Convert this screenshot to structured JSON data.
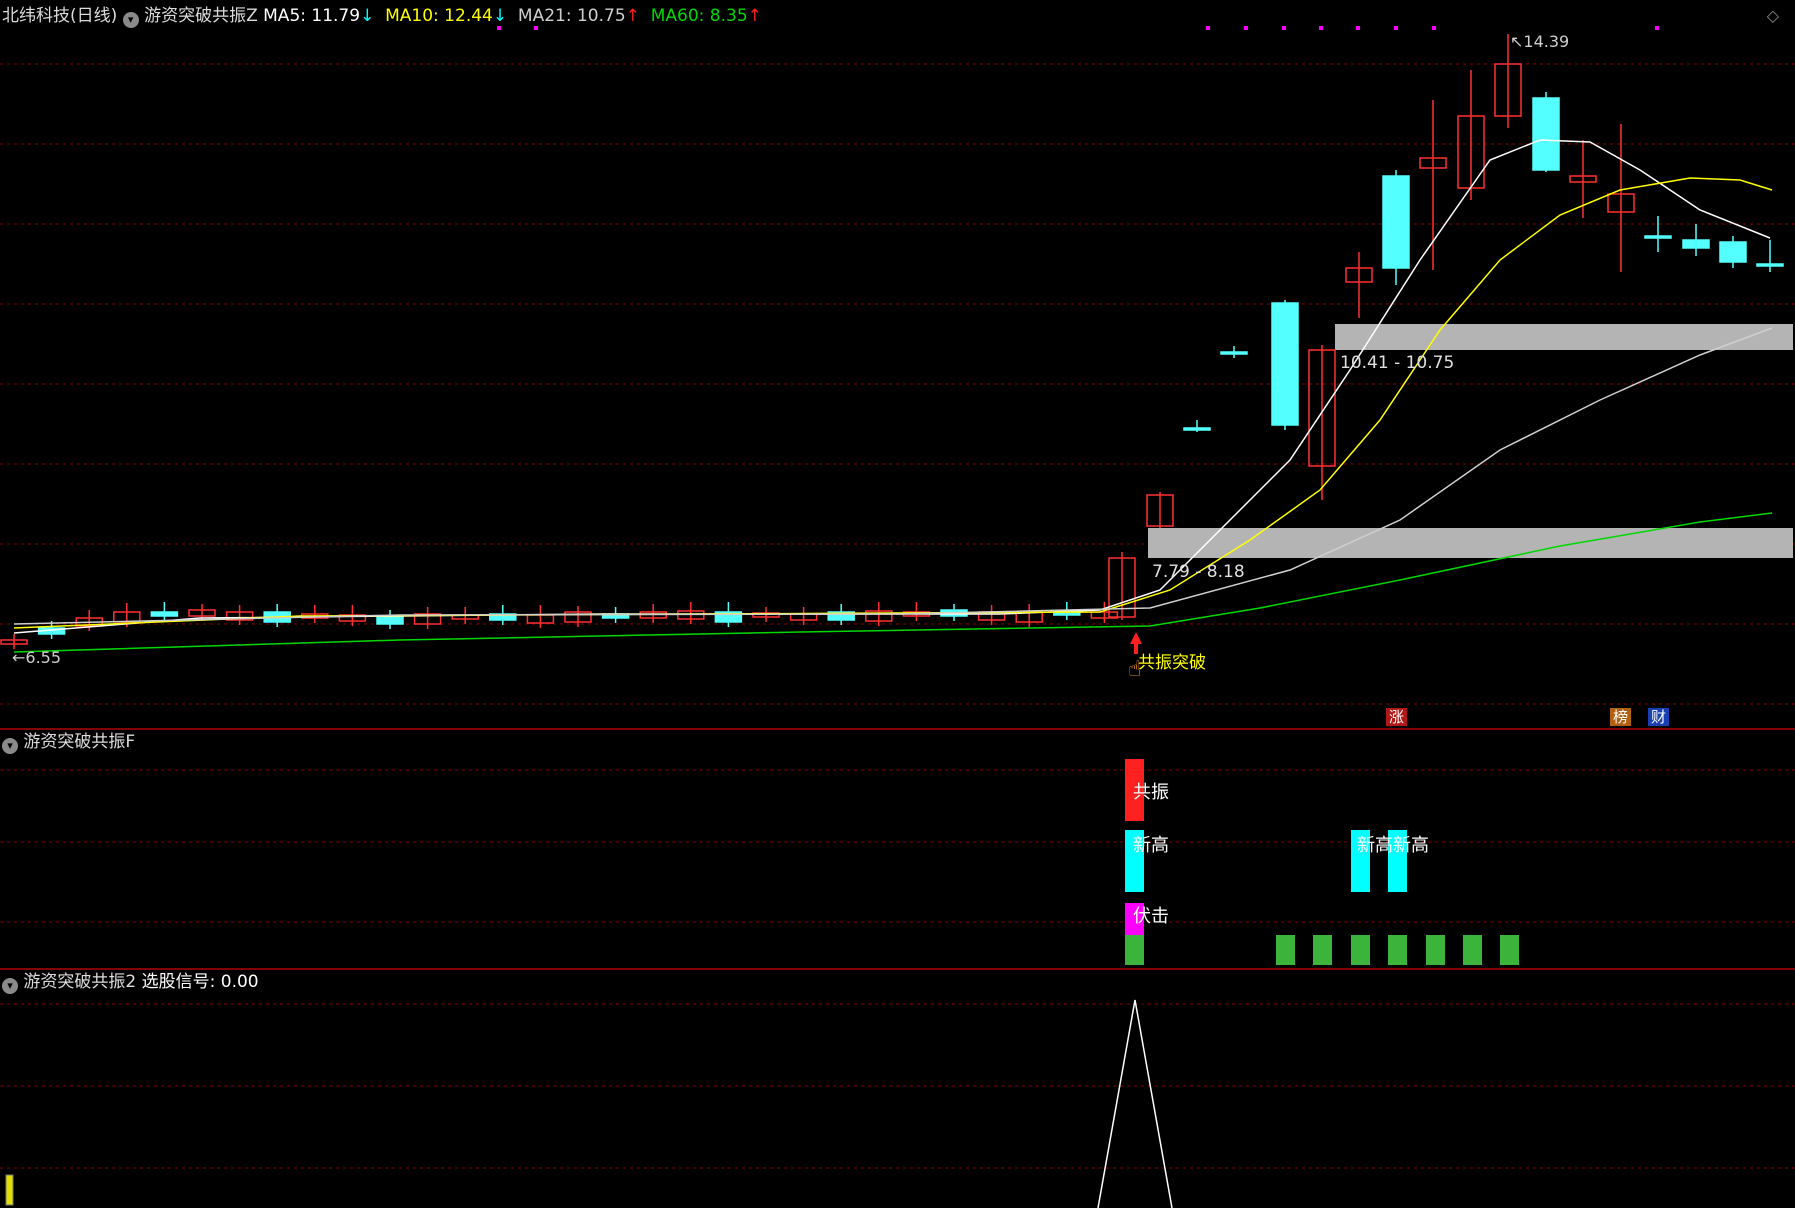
{
  "header": {
    "stock": "北纬科技(日线)",
    "indicator": "游资突破共振Z",
    "ma5": {
      "label": "MA5: 11.79",
      "arrow": "↓",
      "color": "#ffffff",
      "arrow_color": "#00ffff"
    },
    "ma10": {
      "label": "MA10: 12.44",
      "arrow": "↓",
      "color": "#ffff00",
      "arrow_color": "#00ffff"
    },
    "ma21": {
      "label": "MA21: 10.75",
      "arrow": "↑",
      "color": "#cfcfcf",
      "arrow_color": "#ff2020"
    },
    "ma60": {
      "label": "MA60: 8.35",
      "arrow": "↑",
      "color": "#00d800",
      "arrow_color": "#ff2020"
    }
  },
  "main_panel": {
    "high_label": "14.39",
    "low_label": "6.55",
    "zone_upper_label": "10.41 - 10.75",
    "zone_lower_label": "7.79 - 8.18",
    "signal_label": "共振突破",
    "badges": [
      {
        "text": "涨",
        "color": "#b01818"
      },
      {
        "text": "榜",
        "color": "#b06010"
      },
      {
        "text": "财",
        "color": "#1840b0"
      }
    ]
  },
  "panel_f": {
    "title": "游资突破共振F",
    "labels": [
      "共振",
      "新高",
      "新高",
      "新高",
      "伏击"
    ]
  },
  "panel_2": {
    "title": "游资突破共振2",
    "signal_label": "选股信号: 0.00"
  },
  "colors": {
    "up": "#ff3030",
    "down": "#54ffff",
    "grid": "#8b0000",
    "zone": "#b4b4b4"
  },
  "chart_data": {
    "type": "candlestick",
    "y_high": 14.39,
    "y_low": 6.55,
    "moving_averages": [
      "MA5",
      "MA10",
      "MA21",
      "MA60"
    ]
  }
}
